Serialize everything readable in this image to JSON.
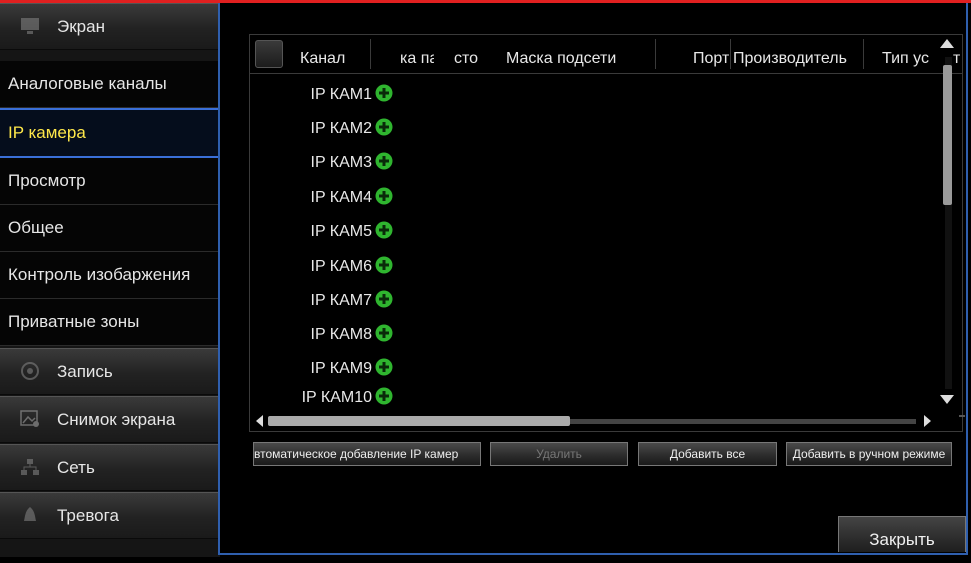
{
  "sidebar": {
    "items": [
      {
        "label": "Экран",
        "type": "category",
        "icon": "monitor-icon"
      },
      {
        "label": "Аналоговые каналы",
        "type": "sub"
      },
      {
        "label": "IP камера",
        "type": "sub",
        "active": true
      },
      {
        "label": "Просмотр",
        "type": "sub"
      },
      {
        "label": "Общее",
        "type": "sub"
      },
      {
        "label": "Контроль изобаржения",
        "type": "sub"
      },
      {
        "label": "Приватные зоны",
        "type": "sub"
      },
      {
        "label": "Запись",
        "type": "category",
        "icon": "record-icon"
      },
      {
        "label": "Снимок экрана",
        "type": "category",
        "icon": "snapshot-icon"
      },
      {
        "label": "Сеть",
        "type": "category",
        "icon": "network-icon"
      },
      {
        "label": "Тревога",
        "type": "category",
        "icon": "alarm-icon"
      }
    ]
  },
  "table": {
    "headers": [
      "Канал",
      "ка пар",
      "сто",
      "Маска подсети",
      "Порт",
      "Производитель",
      "Тип ус",
      "т"
    ],
    "rows": [
      "IP КАМ1",
      "IP КАМ2",
      "IP КАМ3",
      "IP КАМ4",
      "IP КАМ5",
      "IP КАМ6",
      "IP КАМ7",
      "IP КАМ8",
      "IP КАМ9",
      "IP КАМ10"
    ],
    "add_icon": "plus-circle-icon",
    "add_icon_color": "#2fb52f"
  },
  "buttons": {
    "auto_add": "втоматическое добавление IP камер",
    "delete": "Удалить",
    "add_all": "Добавить все",
    "manual_add": "Добавить в ручном режиме",
    "close": "Закрыть"
  },
  "colors": {
    "active_text": "#ffe84a",
    "frame_border": "#2f5fae",
    "top_accent": "#e02020"
  }
}
